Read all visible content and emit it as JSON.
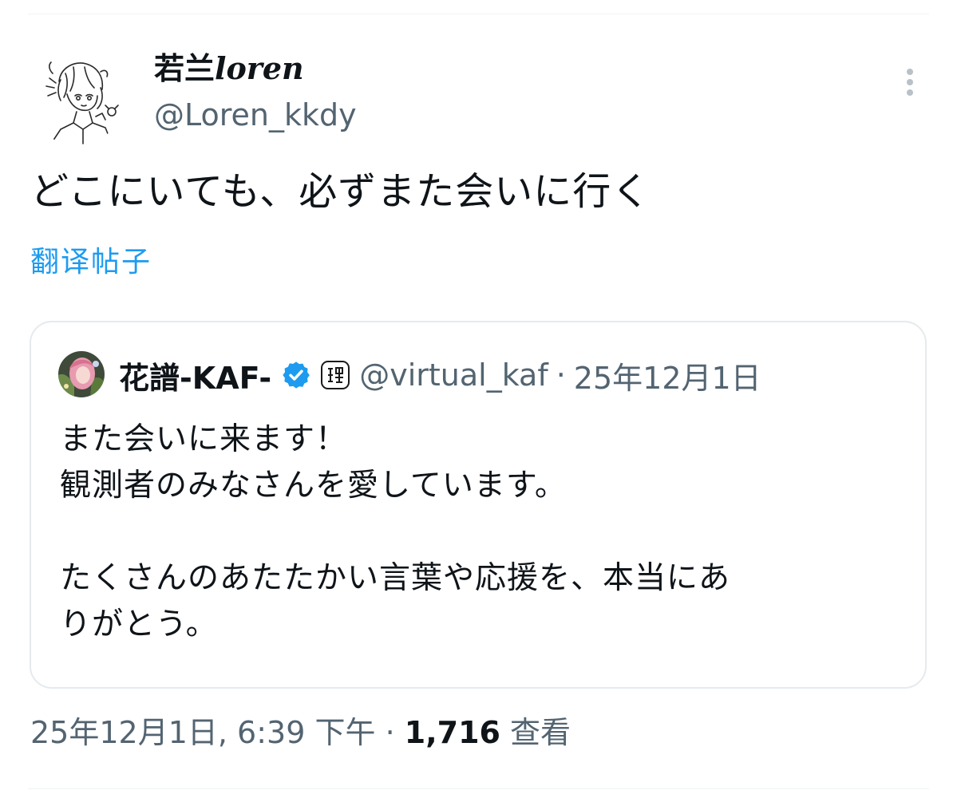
{
  "author": {
    "display_name_cjk": "若兰",
    "display_name_latin": "loren",
    "handle": "@Loren_kkdy"
  },
  "tweet": {
    "text": "どこにいても、必ずまた会いに行く",
    "translate_label": "翻译帖子"
  },
  "quote": {
    "display_name": "花譜-KAF-",
    "handle": "@virtual_kaf",
    "separator": "·",
    "date": "25年12月1日",
    "body_lines": [
      "また会いに来ます！",
      "観測者のみなさんを愛しています。",
      "",
      "たくさんのあたたかい言葉や応援を、本当にあ",
      "りがとう。"
    ]
  },
  "meta": {
    "timestamp": "25年12月1日, 6:39 下午",
    "separator": "·",
    "views_count": "1,716",
    "views_label": "查看"
  },
  "icons": {
    "more": "more-vertical-icon",
    "verified": "verified-badge-icon",
    "affiliation": "affiliation-badge-icon"
  },
  "colors": {
    "link": "#1d9bf0",
    "secondary_text": "#536471",
    "primary_text": "#0f1419"
  }
}
